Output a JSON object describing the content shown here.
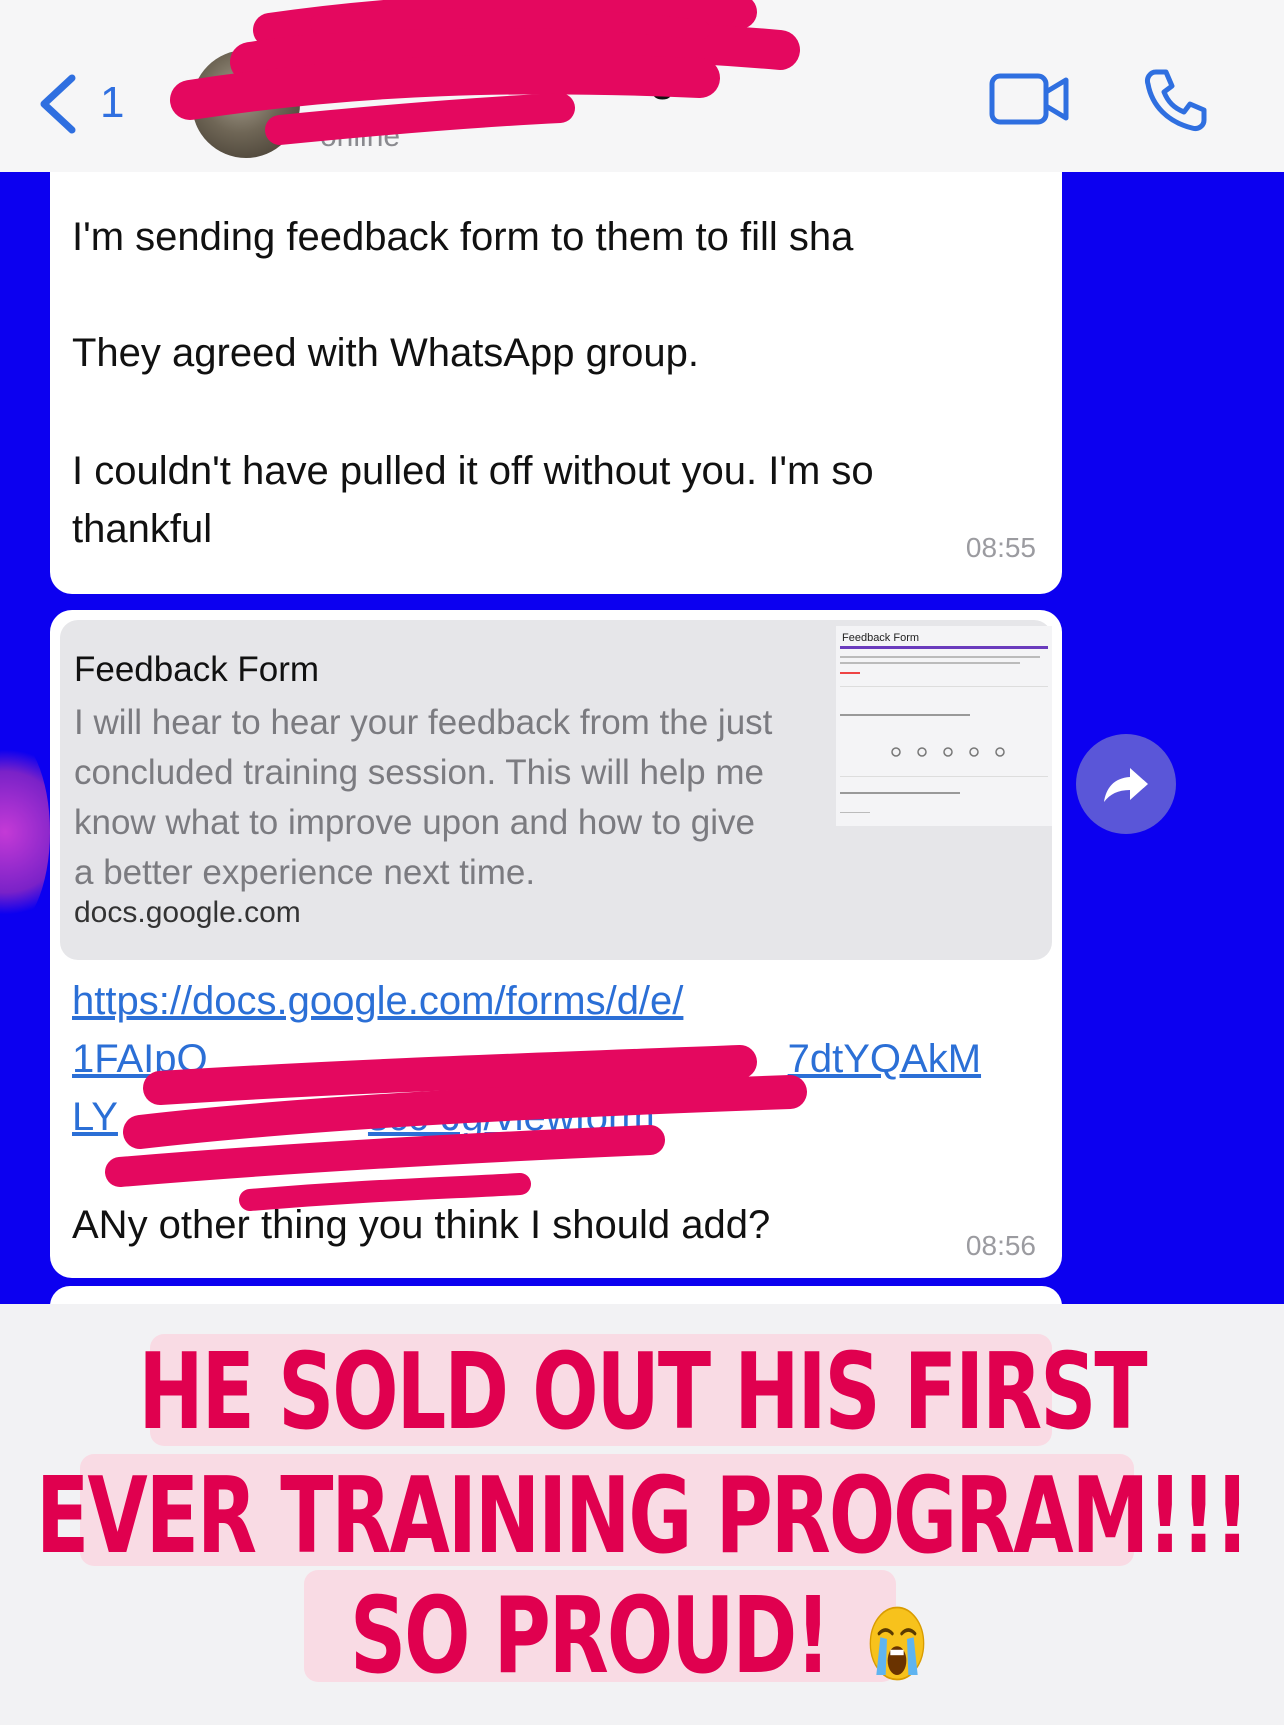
{
  "header": {
    "back_count": "1",
    "contact_name": "ang",
    "contact_status": "online",
    "icons": {
      "back": "chevron-left-icon",
      "video": "video-camera-icon",
      "call": "phone-icon"
    },
    "accent_color": "#2f6fe0"
  },
  "messages": [
    {
      "lines": [
        "I'm sending feedback form to them to fill sha",
        "They agreed with WhatsApp group.",
        "I couldn't have pulled it off without you. I'm so thankful"
      ],
      "time": "08:55"
    },
    {
      "link_preview": {
        "title": "Feedback Form",
        "description": "I will hear to hear your feedback from the just concluded training session. This will help me know what to improve upon and how to give a better experience next time.",
        "domain": "docs.google.com",
        "thumbnail_title": "Feedback Form"
      },
      "link_lines": [
        "https://docs.google.com/forms/d/e/",
        "1FAIpQ",
        "7dtYQAkM",
        "LY",
        "scc-Jg/viewform"
      ],
      "question": "ANy other thing you think I should add?",
      "time": "08:56"
    }
  ],
  "forward_icon": "forward-arrow-icon",
  "caption": {
    "line1": "HE SOLD OUT HIS FIRST",
    "line2": "EVER TRAINING PROGRAM!!!",
    "line3": "SO PROUD!",
    "emoji": "crying-face-icon",
    "color": "#e0004f",
    "highlight": "#f9dbe4"
  },
  "chat_background": "#0c00f0",
  "redaction_color": "#e4085f"
}
